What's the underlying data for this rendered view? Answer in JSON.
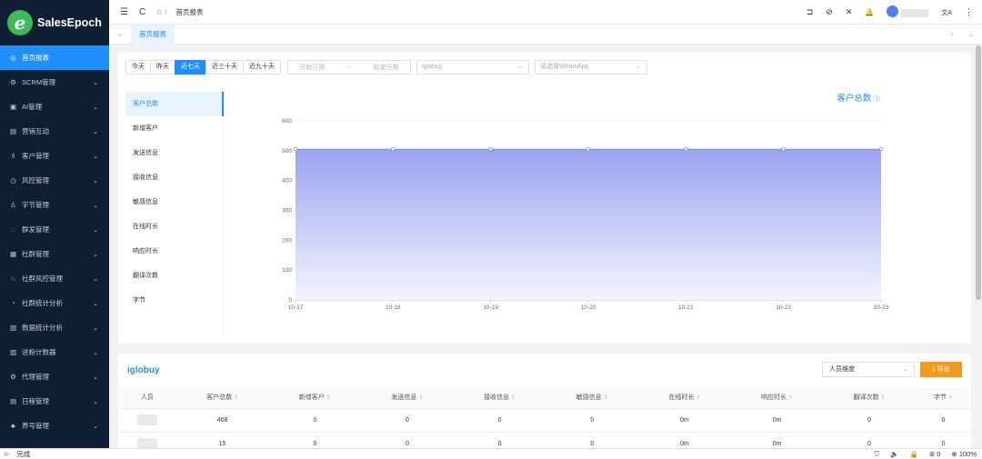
{
  "app": {
    "name": "SalesEpoch",
    "logo_letter": "e"
  },
  "sidebar": {
    "items": [
      {
        "label": "首页报表",
        "icon": "◎",
        "active": true,
        "chevron": ""
      },
      {
        "label": "SCRM管理",
        "icon": "⚙",
        "chevron": "⌄"
      },
      {
        "label": "AI管理",
        "icon": "▣",
        "chevron": "⌄"
      },
      {
        "label": "营销互动",
        "icon": "▤",
        "chevron": "⌄"
      },
      {
        "label": "客户管理",
        "icon": "♗",
        "chevron": "⌄"
      },
      {
        "label": "风控管理",
        "icon": "◷",
        "chevron": "⌄"
      },
      {
        "label": "字节管理",
        "icon": "♙",
        "chevron": "⌄"
      },
      {
        "label": "群发管理",
        "icon": "◌",
        "chevron": "⌄"
      },
      {
        "label": "社群管理",
        "icon": "▦",
        "chevron": "⌄"
      },
      {
        "label": "社群风控管理",
        "icon": "♘",
        "chevron": "⌄"
      },
      {
        "label": "社群统计分析",
        "icon": "◔",
        "chevron": "⌄"
      },
      {
        "label": "数据统计分析",
        "icon": "▥",
        "chevron": "⌄"
      },
      {
        "label": "进粉计数器",
        "icon": "▨",
        "chevron": "⌄"
      },
      {
        "label": "代理管理",
        "icon": "⚙",
        "chevron": "⌄"
      },
      {
        "label": "日程管理",
        "icon": "▤",
        "chevron": "⌄"
      },
      {
        "label": "养号管理",
        "icon": "♣",
        "chevron": "⌄"
      }
    ]
  },
  "topbar": {
    "menu_icon": "☰",
    "refresh_icon": "C",
    "home_icon": "⌂",
    "crumb_sep": "/",
    "breadcrumb": "首页报表",
    "right_icons": [
      "⊐",
      "⊘",
      "✕",
      "🔔"
    ],
    "translate_icon": "文A",
    "more_icon": "⋮"
  },
  "tabs": {
    "left_arrow": "‹",
    "active": "首页报表",
    "right_arrow": "›",
    "expand_icon": "⌄"
  },
  "filters": {
    "ranges": [
      "今天",
      "昨天",
      "近七天",
      "近三十天",
      "近九十天"
    ],
    "active_range": 2,
    "start_placeholder": "开始日期",
    "range_sep": "~",
    "end_placeholder": "结束日期",
    "account_select": "iglobuy",
    "whatsapp_placeholder": "请选择WhatsApp",
    "dropdown_arrow": "⌄"
  },
  "metrics": [
    "客户总数",
    "新增客户",
    "发送信息",
    "接收信息",
    "敏感信息",
    "在线时长",
    "响应时长",
    "翻译次数",
    "字节"
  ],
  "active_metric": 0,
  "chart_title": "客户总数",
  "chart_info_icon": "ⓘ",
  "chart_data": {
    "type": "area",
    "title": "客户总数",
    "x": [
      "10-17",
      "10-18",
      "10-19",
      "10-20",
      "10-21",
      "10-22",
      "10-23"
    ],
    "series": [
      {
        "values": [
          505,
          505,
          505,
          505,
          505,
          505,
          505
        ]
      }
    ],
    "ylim": [
      0,
      600
    ],
    "yticks": [
      0,
      100,
      200,
      300,
      400,
      500,
      600
    ],
    "grid": true,
    "colors": {
      "line": "#7b88e6",
      "fill_top": "#9aa3f0",
      "fill_bottom": "#f3f4fd"
    }
  },
  "table": {
    "title": "iglobuy",
    "dimension_select": "人员维度",
    "dimension_arrow": "⌄",
    "export_icon": "⤓",
    "export_label": "导出",
    "sort_icon": "⇕",
    "columns": [
      "人员",
      "客户总数",
      "新增客户",
      "发送信息",
      "接收信息",
      "敏感信息",
      "在线时长",
      "响应时长",
      "翻译次数",
      "字节"
    ],
    "rows": [
      [
        "",
        "468",
        "0",
        "0",
        "0",
        "0",
        "0m",
        "0m",
        "0",
        "0"
      ],
      [
        "",
        "15",
        "0",
        "0",
        "0",
        "0",
        "0m",
        "0m",
        "0",
        "0"
      ]
    ]
  },
  "statusbar": {
    "icon": "⊳",
    "status": "完成",
    "right_icons": [
      "⛉",
      "🔈",
      "🔒"
    ],
    "ad_icon": "⊚",
    "ad_count": "0",
    "zoom_icon": "⊕",
    "zoom": "100%"
  }
}
